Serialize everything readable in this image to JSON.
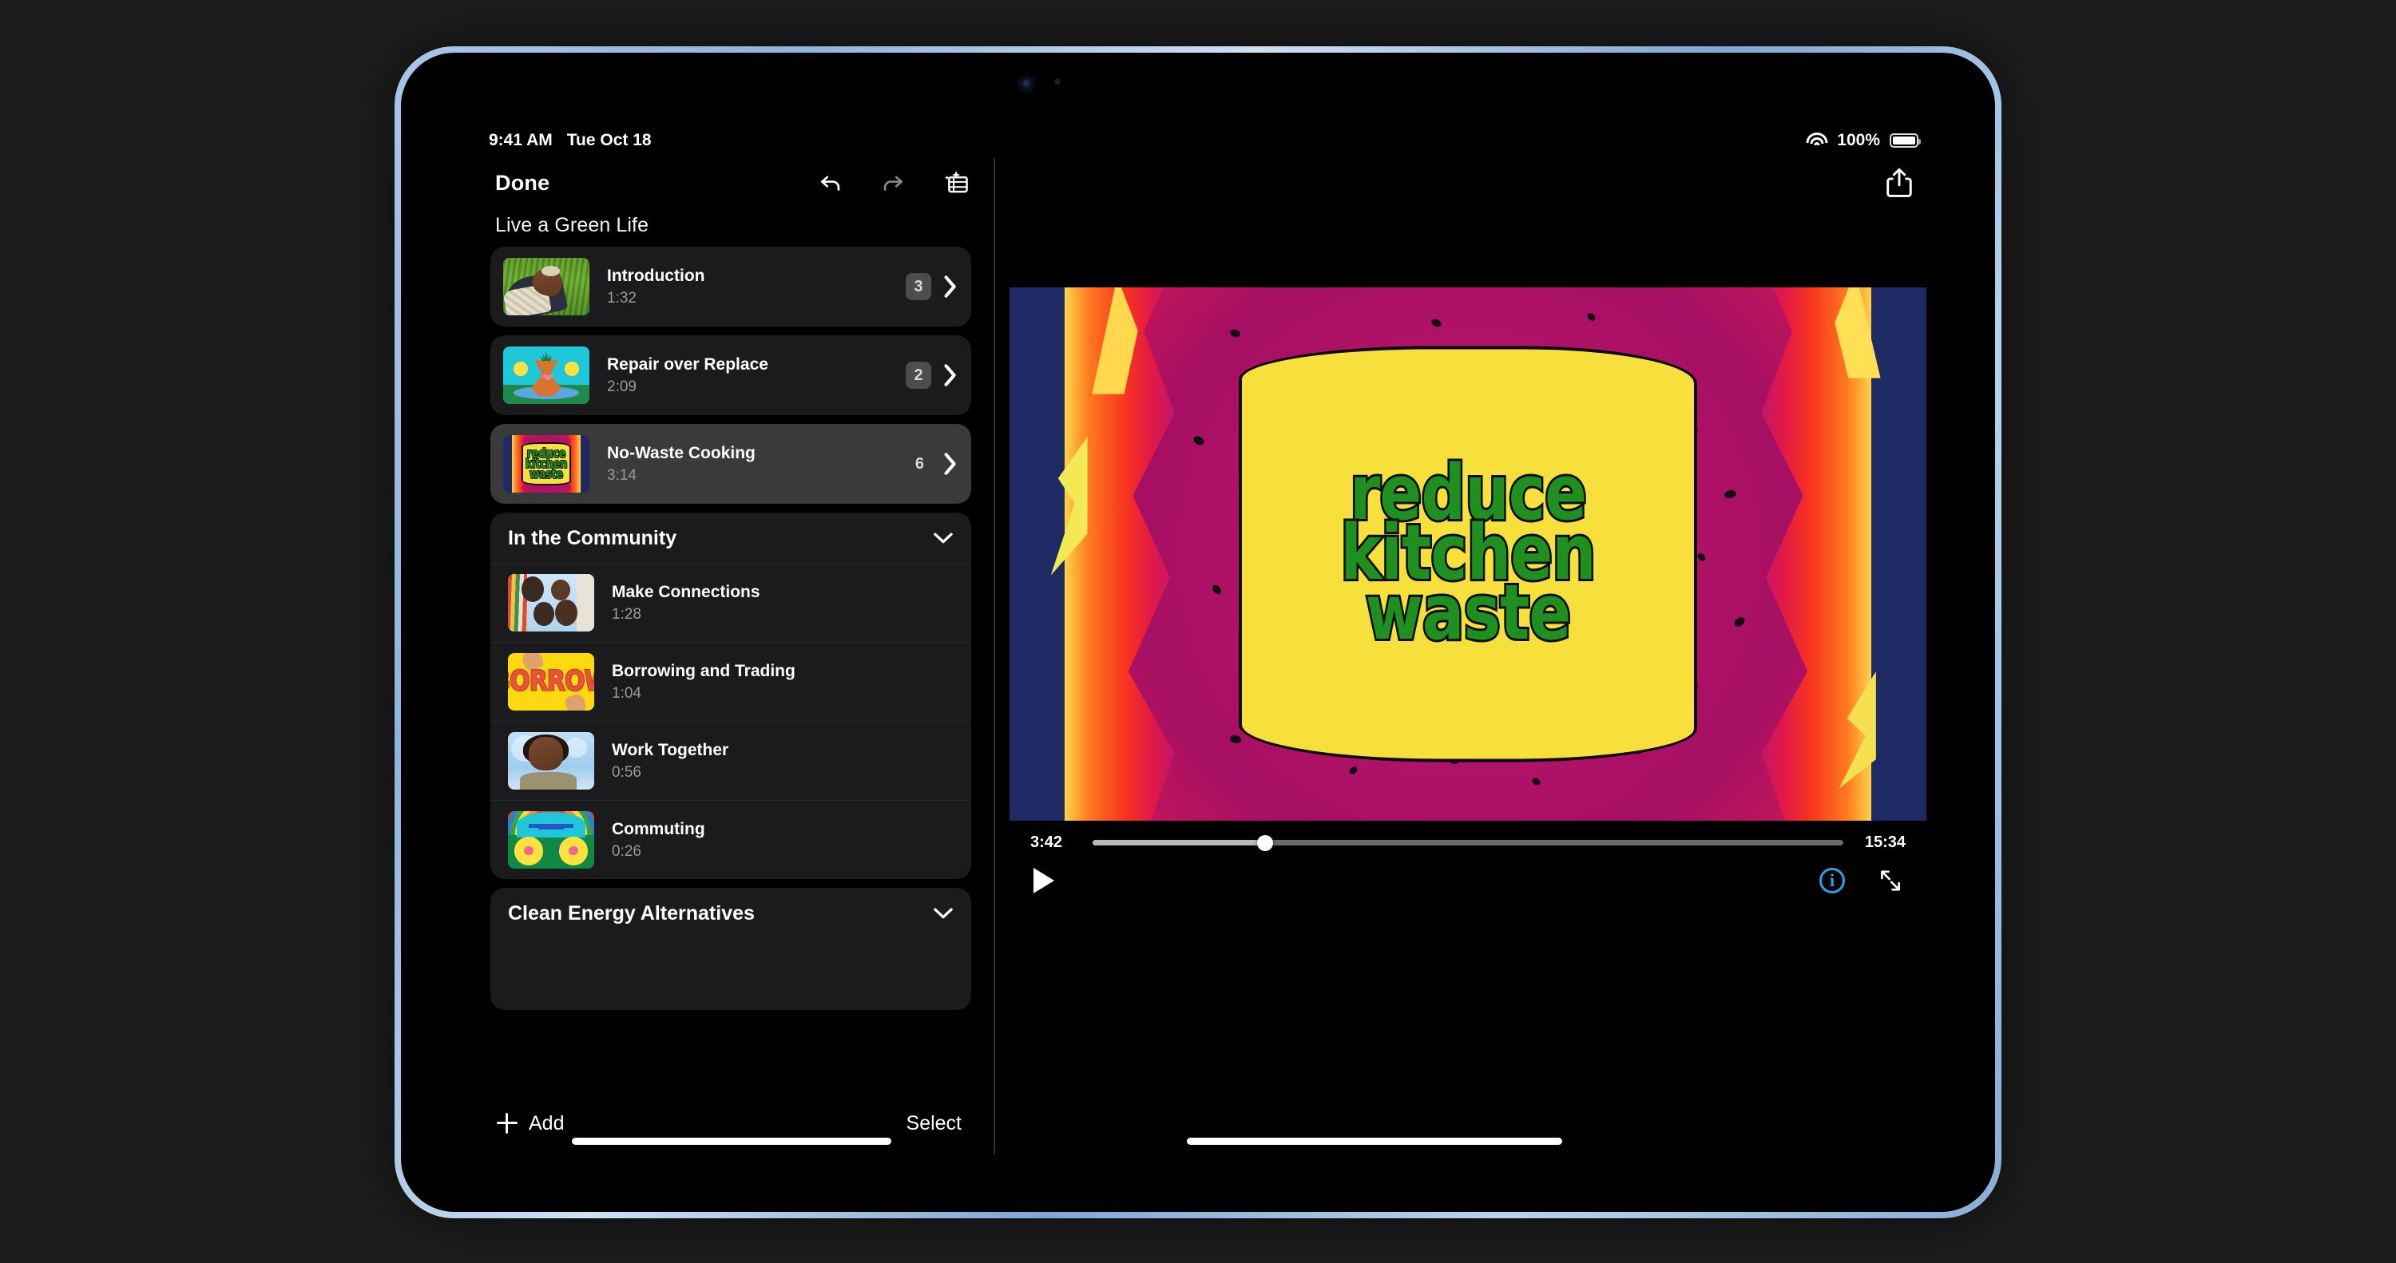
{
  "status_bar": {
    "time": "9:41 AM",
    "date": "Tue Oct 18",
    "battery_percent": "100%",
    "wifi_icon": "wifi-icon",
    "battery_icon": "battery-full-icon"
  },
  "nav": {
    "done_label": "Done",
    "undo_icon": "undo-arrow-icon",
    "redo_icon": "redo-arrow-icon",
    "magic_movie_icon": "magic-movie-film-icon",
    "share_icon": "share-upload-icon"
  },
  "sidebar": {
    "project_title": "Live a Green Life",
    "chapters": [
      {
        "name": "Introduction",
        "duration": "1:32",
        "count": "3",
        "badge": true,
        "selected": false,
        "thumb": "person-on-grass-thumbnail",
        "chevron_icon": "chevron-right-icon"
      },
      {
        "name": "Repair over Replace",
        "duration": "2:09",
        "count": "2",
        "badge": true,
        "selected": false,
        "thumb": "repaired-vase-thumbnail",
        "chevron_icon": "chevron-right-icon"
      },
      {
        "name": "No-Waste Cooking",
        "duration": "3:14",
        "count": "6",
        "badge": false,
        "selected": true,
        "thumb": "reduce-kitchen-waste-thumbnail",
        "chevron_icon": "chevron-right-icon"
      }
    ],
    "groups": [
      {
        "title": "In the Community",
        "collapse_icon": "chevron-down-icon",
        "items": [
          {
            "name": "Make Connections",
            "duration": "1:28",
            "thumb": "people-circle-thumbnail"
          },
          {
            "name": "Borrowing and Trading",
            "duration": "1:04",
            "thumb": "borrow-lettering-thumbnail",
            "thumb_text": "BORROW"
          },
          {
            "name": "Work Together",
            "duration": "0:56",
            "thumb": "person-portrait-thumbnail"
          },
          {
            "name": "Commuting",
            "duration": "0:26",
            "thumb": "bicycle-flowers-thumbnail"
          }
        ]
      },
      {
        "title": "Clean Energy Alternatives",
        "collapse_icon": "chevron-down-icon",
        "items": []
      }
    ],
    "toolbar": {
      "add_label": "Add",
      "add_icon": "plus-icon",
      "select_label": "Select"
    }
  },
  "player": {
    "video_title_lines": [
      "reduce",
      "kitchen",
      "waste"
    ],
    "current_time": "3:42",
    "total_time": "15:34",
    "progress_percent": 23,
    "play_icon": "play-triangle-icon",
    "info_icon": "info-circle-icon",
    "info_glyph": "i",
    "expand_icon": "expand-arrows-icon"
  },
  "colors": {
    "selected_card": "#3a3a3c",
    "card": "#1b1b1d",
    "accent_info": "#2e9fe8",
    "video_bg": "#1d2a63",
    "video_label_yellow": "#f7e03c",
    "video_text_green": "#1f8f1f",
    "device_bezel": "#a9c6e8"
  }
}
